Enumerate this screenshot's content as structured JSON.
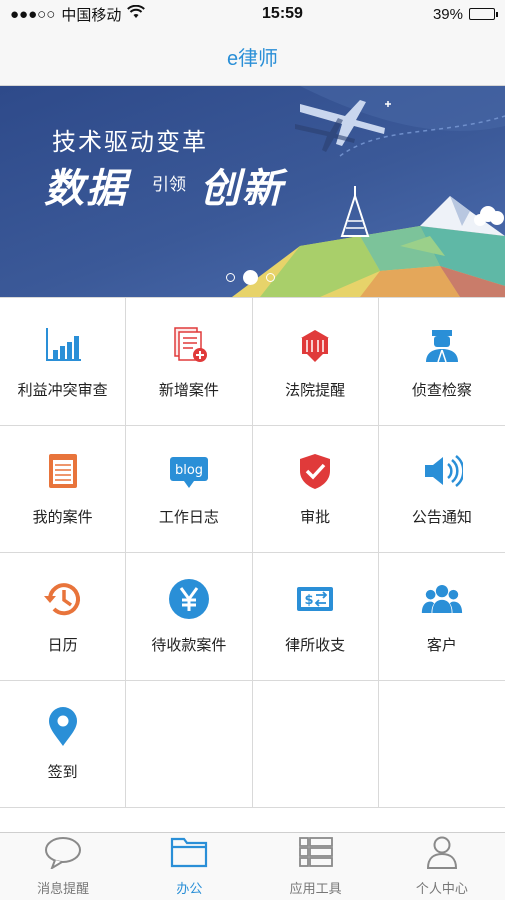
{
  "status_bar": {
    "signal": "●●●○○",
    "carrier": "中国移动",
    "time": "15:59",
    "battery_pct": "39%",
    "battery_level": 0.39
  },
  "nav": {
    "title": "e律师"
  },
  "banner": {
    "line1": "技术驱动变革",
    "big1": "数据",
    "small": "引领",
    "big2": "创新",
    "active_slide": 2,
    "slide_count": 3
  },
  "grid": [
    {
      "label": "利益冲突审查",
      "icon": "bar-chart-icon"
    },
    {
      "label": "新增案件",
      "icon": "add-document-icon"
    },
    {
      "label": "法院提醒",
      "icon": "court-building-icon"
    },
    {
      "label": "侦查检察",
      "icon": "police-officer-icon"
    },
    {
      "label": "我的案件",
      "icon": "case-list-icon"
    },
    {
      "label": "工作日志",
      "icon": "blog-icon"
    },
    {
      "label": "审批",
      "icon": "shield-check-icon"
    },
    {
      "label": "公告通知",
      "icon": "speaker-icon"
    },
    {
      "label": "日历",
      "icon": "history-clock-icon"
    },
    {
      "label": "待收款案件",
      "icon": "yen-icon"
    },
    {
      "label": "律所收支",
      "icon": "money-transfer-icon"
    },
    {
      "label": "客户",
      "icon": "customers-icon"
    },
    {
      "label": "签到",
      "icon": "location-pin-icon"
    }
  ],
  "tabs": [
    {
      "label": "消息提醒",
      "icon": "chat-bubble-icon",
      "active": false
    },
    {
      "label": "办公",
      "icon": "folder-icon",
      "active": true
    },
    {
      "label": "应用工具",
      "icon": "list-tools-icon",
      "active": false
    },
    {
      "label": "个人中心",
      "icon": "person-icon",
      "active": false
    }
  ],
  "colors": {
    "accent": "#2a8fd7",
    "red": "#e03a3a",
    "orange": "#e8743b",
    "banner_bg": "#3b5998"
  }
}
